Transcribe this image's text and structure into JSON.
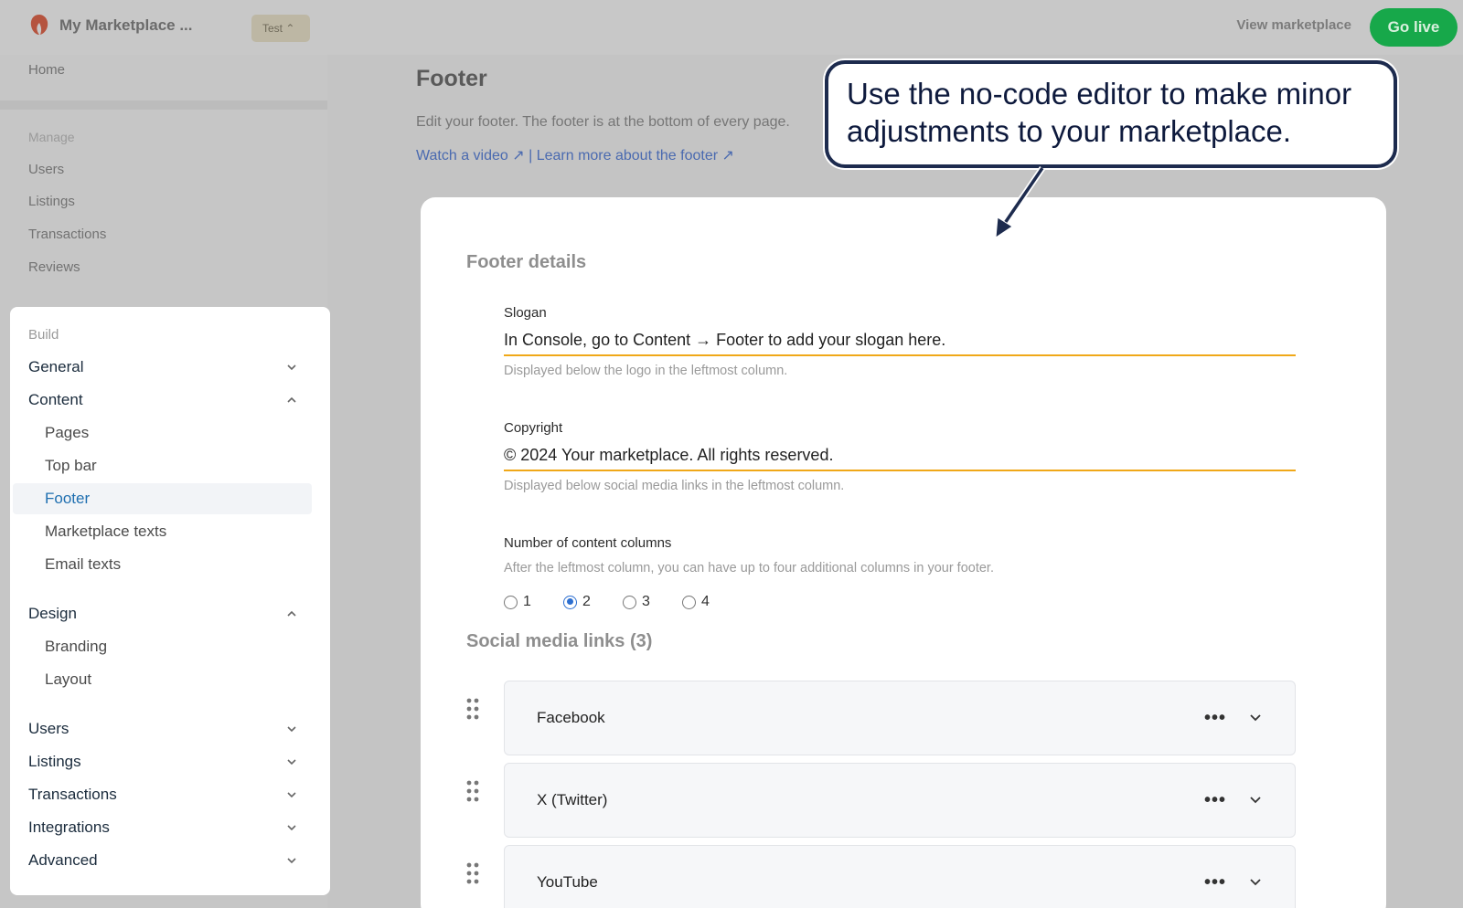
{
  "app": {
    "title": "My Marketplace ...",
    "env_badge": "Test",
    "view_link": "View marketplace",
    "go_live": "Go live"
  },
  "sidebar": {
    "home": "Home",
    "manage_label": "Manage",
    "manage_items": [
      "Users",
      "Listings",
      "Transactions",
      "Reviews"
    ],
    "build_label": "Build",
    "build_items": [
      {
        "label": "General",
        "chevron": "chevron-down-icon"
      },
      {
        "label": "Content",
        "chevron": "chevron-up-icon"
      },
      {
        "label": "Pages"
      },
      {
        "label": "Top bar"
      },
      {
        "label": "Footer",
        "active": true
      },
      {
        "label": "Marketplace texts"
      },
      {
        "label": "Email texts"
      },
      {
        "label": "Design",
        "chevron": "chevron-up-icon"
      },
      {
        "label": "Branding"
      },
      {
        "label": "Layout"
      },
      {
        "label": "Users",
        "chevron": "chevron-down-icon"
      },
      {
        "label": "Listings",
        "chevron": "chevron-down-icon"
      },
      {
        "label": "Transactions",
        "chevron": "chevron-down-icon"
      },
      {
        "label": "Integrations",
        "chevron": "chevron-down-icon"
      },
      {
        "label": "Advanced",
        "chevron": "chevron-down-icon"
      }
    ]
  },
  "page": {
    "title": "Footer",
    "description": "Edit your footer. The footer is at the bottom of every page.",
    "link_video": "Watch a video ↗",
    "link_separator": "|",
    "link_learn": "Learn more about the footer ↗"
  },
  "footer_details": {
    "section_title": "Footer details",
    "slogan_label": "Slogan",
    "slogan_value": "In Console, go to Content → Footer to add your slogan here.",
    "slogan_help": "Displayed below the logo in the leftmost column.",
    "copyright_label": "Copyright",
    "copyright_value": "© 2024 Your marketplace. All rights reserved.",
    "copyright_help": "Displayed below social media links in the leftmost column.",
    "columns_label": "Number of content columns",
    "columns_help": "After the leftmost column, you can have up to four additional columns in your footer.",
    "column_options": [
      "1",
      "2",
      "3",
      "4"
    ],
    "columns_selected": "2"
  },
  "social": {
    "section_title": "Social media links (3)",
    "links": [
      "Facebook",
      "X (Twitter)",
      "YouTube"
    ]
  },
  "callout": {
    "text": "Use the no-code editor to make minor adjustments to your marketplace."
  },
  "colors": {
    "accent": "#1f6fb0",
    "go_live": "#17a84a",
    "input_underline": "#f0a818",
    "callout_border": "#1d2b4e"
  }
}
